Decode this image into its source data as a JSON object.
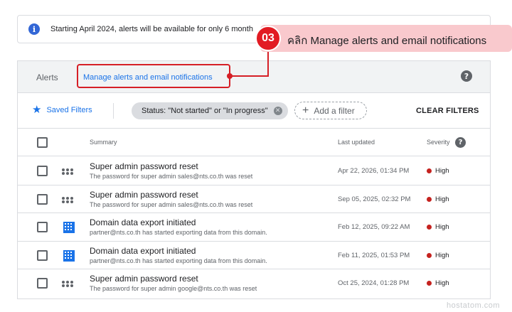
{
  "banner": {
    "icon": "info-icon",
    "text": "Starting April 2024, alerts will be available for only 6 month"
  },
  "header": {
    "title": "Alerts",
    "manage_link": "Manage alerts and email notifications",
    "help_icon": "?"
  },
  "filters": {
    "saved_filters_label": "Saved Filters",
    "chip_label": "Status: \"Not started\" or \"In progress\"",
    "add_filter_label": "Add a filter",
    "clear_filters_label": "CLEAR FILTERS"
  },
  "table": {
    "columns": {
      "summary": "Summary",
      "last_updated": "Last updated",
      "severity": "Severity"
    },
    "rows": [
      {
        "icon": "dots-icon",
        "title": "Super admin password reset",
        "subtitle": "The password for super admin sales@nts.co.th was reset",
        "date": "Apr 22, 2026, 01:34 PM",
        "severity": "High"
      },
      {
        "icon": "dots-icon",
        "title": "Super admin password reset",
        "subtitle": "The password for super admin sales@nts.co.th was reset",
        "date": "Sep 05, 2025, 02:32 PM",
        "severity": "High"
      },
      {
        "icon": "building-icon",
        "title": "Domain data export initiated",
        "subtitle": "partner@nts.co.th has started exporting data from this domain.",
        "date": "Feb 12, 2025, 09:22 AM",
        "severity": "High"
      },
      {
        "icon": "building-icon",
        "title": "Domain data export initiated",
        "subtitle": "partner@nts.co.th has started exporting data from this domain.",
        "date": "Feb 11, 2025, 01:53 PM",
        "severity": "High"
      },
      {
        "icon": "dots-icon",
        "title": "Super admin password reset",
        "subtitle": "The password for super admin google@nts.co.th was reset",
        "date": "Oct 25, 2024, 01:28 PM",
        "severity": "High"
      }
    ]
  },
  "callout": {
    "step": "03",
    "text": "คลิก Manage alerts and email notifications"
  },
  "watermark": "hostatom.com",
  "colors": {
    "accent": "#1a73e8",
    "callout_red": "#e21b23",
    "callout_bg": "#f9c9cd",
    "severity_high": "#c5221f"
  }
}
